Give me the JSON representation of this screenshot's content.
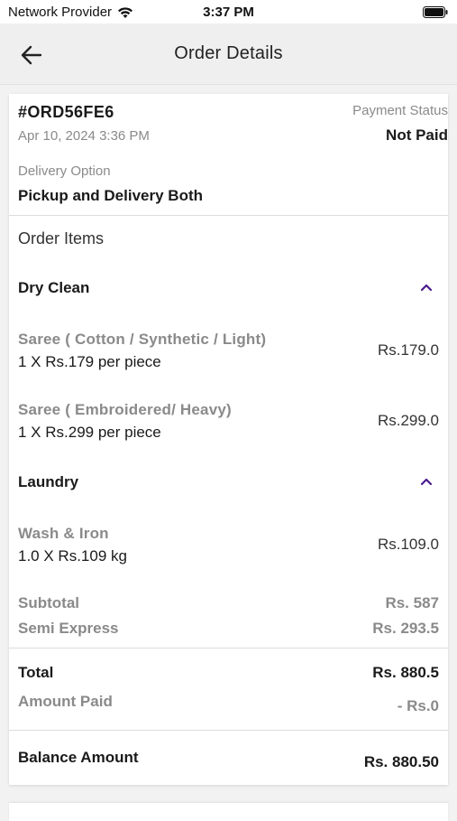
{
  "status_bar": {
    "carrier": "Network Provider",
    "time": "3:37 PM",
    "wifi_icon": "wifi-icon",
    "battery_icon": "battery-icon"
  },
  "header": {
    "back_icon": "arrow-left-icon",
    "title": "Order Details"
  },
  "order": {
    "id": "#ORD56FE6",
    "date": "Apr 10, 2024 3:36 PM",
    "payment_status_label": "Payment Status",
    "payment_status": "Not Paid",
    "delivery_option_label": "Delivery Option",
    "delivery_option": "Pickup and Delivery Both"
  },
  "items_section": {
    "title": "Order Items",
    "categories": [
      {
        "name": "Dry Clean",
        "expanded_icon": "chevron-up-icon",
        "items": [
          {
            "name": "Saree ( Cotton / Synthetic / Light)",
            "qty": "1 X Rs.179 per piece",
            "price": "Rs.179.0"
          },
          {
            "name": "Saree ( Embroidered/ Heavy)",
            "qty": "1 X Rs.299 per piece",
            "price": "Rs.299.0"
          }
        ]
      },
      {
        "name": "Laundry",
        "expanded_icon": "chevron-up-icon",
        "items": [
          {
            "name": "Wash & Iron",
            "qty": "1.0 X Rs.109 kg",
            "price": "Rs.109.0"
          }
        ]
      }
    ]
  },
  "summary": {
    "subtotal_label": "Subtotal",
    "subtotal_value": "Rs. 587",
    "express_label": "Semi Express",
    "express_value": "Rs. 293.5",
    "total_label": "Total",
    "total_value": "Rs. 880.5",
    "paid_label": "Amount Paid",
    "paid_value": "- Rs.0",
    "balance_label": "Balance Amount",
    "balance_value": "Rs. 880.50"
  },
  "colors": {
    "accent": "#4a1a8c",
    "muted_text": "#8a8a8a",
    "app_bar_bg": "#efefef"
  }
}
